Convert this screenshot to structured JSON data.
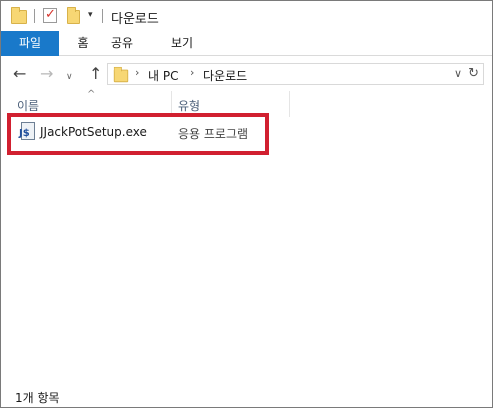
{
  "window": {
    "title": "다운로드"
  },
  "quick_access": {
    "icons": [
      "folder-icon",
      "properties-icon",
      "new-folder-icon",
      "customize-dropdown-icon"
    ]
  },
  "ribbon": {
    "tabs": [
      {
        "label": "파일",
        "active": true
      },
      {
        "label": "홈"
      },
      {
        "label": "공유"
      },
      {
        "label": "보기"
      }
    ],
    "accent_color": "#1979ca"
  },
  "navigation": {
    "back_glyph": "←",
    "forward_glyph": "→",
    "recent_glyph": "∨",
    "up_glyph": "↑",
    "breadcrumb": [
      "내 PC",
      "다운로드"
    ],
    "breadcrumb_separator": "›",
    "dropdown_glyph": "∨",
    "refresh_glyph": "↻"
  },
  "columns": {
    "name": "이름",
    "type": "유형",
    "sort_glyph": "^"
  },
  "files": [
    {
      "name": "JJackPotSetup.exe",
      "type": "응용 프로그램",
      "icon": "installer-icon",
      "icon_label": "J$",
      "highlighted": true
    }
  ],
  "highlight_color": "#d12030",
  "status_bar": {
    "item_count": "1개 항목"
  }
}
